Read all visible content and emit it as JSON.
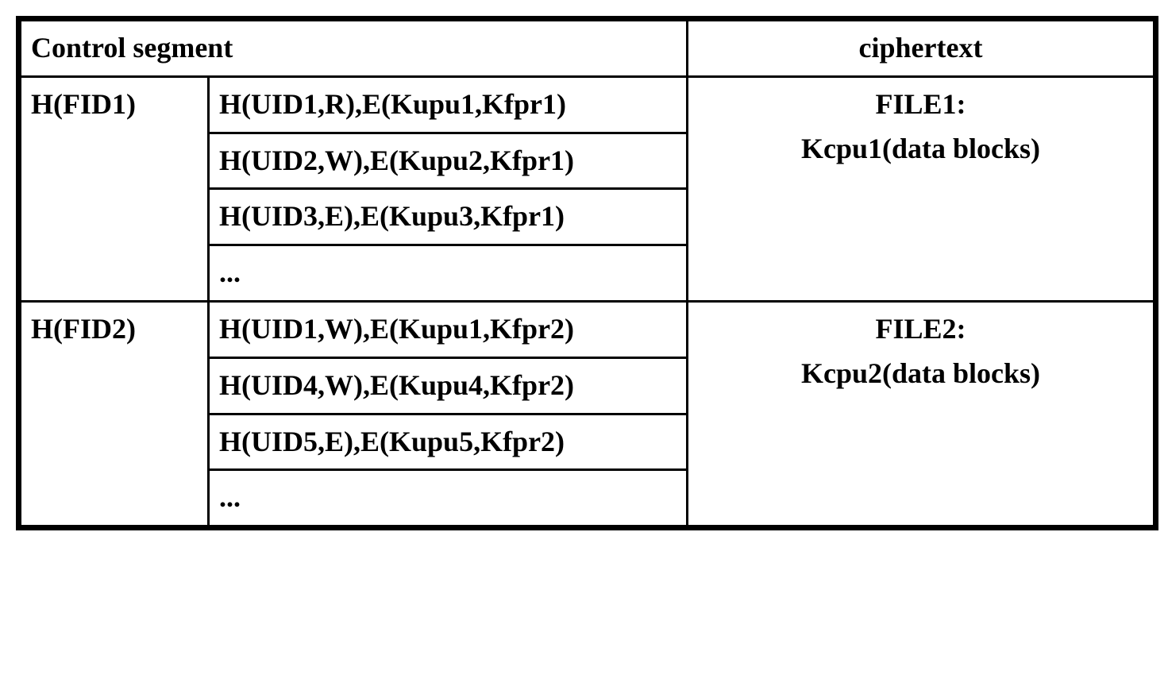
{
  "headers": {
    "control_segment": "Control segment",
    "ciphertext": "ciphertext"
  },
  "rows": [
    {
      "fid": "H(FID1)",
      "entries": [
        "H(UID1,R),E(Kupu1,Kfpr1)",
        "H(UID2,W),E(Kupu2,Kfpr1)",
        "H(UID3,E),E(Kupu3,Kfpr1)",
        "..."
      ],
      "cipher_file": "FILE1:",
      "cipher_data": "Kcpu1(data blocks)"
    },
    {
      "fid": "H(FID2)",
      "entries": [
        "H(UID1,W),E(Kupu1,Kfpr2)",
        "H(UID4,W),E(Kupu4,Kfpr2)",
        "H(UID5,E),E(Kupu5,Kfpr2)",
        "..."
      ],
      "cipher_file": "FILE2:",
      "cipher_data": "Kcpu2(data blocks)"
    }
  ]
}
